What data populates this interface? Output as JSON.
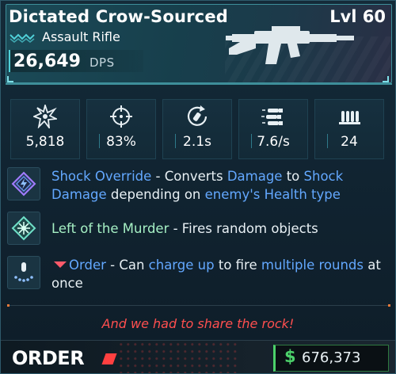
{
  "colors": {
    "accent": "#3e8f9a",
    "highlight_blue": "#63a8ff",
    "highlight_green": "#a6f0c4",
    "flavor_red": "#ff4f4f",
    "money_green": "#4cd06a"
  },
  "weapon": {
    "name": "Dictated Crow-Sourced",
    "level": "Lvl 60",
    "type": "Assault Rifle",
    "rarity_icon": "rarity-chevrons-icon",
    "image": "assault-rifle-icon",
    "dps_value": "26,649",
    "dps_label": "DPS"
  },
  "stats": [
    {
      "icon": "damage-burst-icon",
      "value": "5,818"
    },
    {
      "icon": "accuracy-crosshair-icon",
      "value": "83%"
    },
    {
      "icon": "reload-icon",
      "value": "2.1s"
    },
    {
      "icon": "fire-rate-bullets-icon",
      "value": "7.6/s"
    },
    {
      "icon": "magazine-icon",
      "value": "24"
    }
  ],
  "perks": [
    {
      "icon": "shock-override-icon",
      "segments": [
        {
          "text": "Shock Override",
          "style": "blue"
        },
        {
          "text": " - Converts ",
          "style": "plain"
        },
        {
          "text": "Damage",
          "style": "blue"
        },
        {
          "text": " to ",
          "style": "plain"
        },
        {
          "text": "Shock Damage",
          "style": "blue"
        },
        {
          "text": " depending on ",
          "style": "plain"
        },
        {
          "text": "enemy's Health type",
          "style": "blue"
        }
      ]
    },
    {
      "icon": "left-of-murder-icon",
      "segments": [
        {
          "text": "Left of the Murder",
          "style": "green"
        },
        {
          "text": " - Fires random objects",
          "style": "plain"
        }
      ]
    },
    {
      "icon": "order-charge-icon",
      "segments": [
        {
          "text": "Order",
          "style": "blue"
        },
        {
          "text": " - Can ",
          "style": "plain"
        },
        {
          "text": "charge up",
          "style": "blue"
        },
        {
          "text": " to fire ",
          "style": "plain"
        },
        {
          "text": "multiple rounds",
          "style": "blue"
        },
        {
          "text": " at once",
          "style": "plain"
        }
      ]
    }
  ],
  "flavor_text": "And we had to share the rock!",
  "manufacturer": "ORDER",
  "price": {
    "currency_symbol": "$",
    "value": "676,373"
  }
}
